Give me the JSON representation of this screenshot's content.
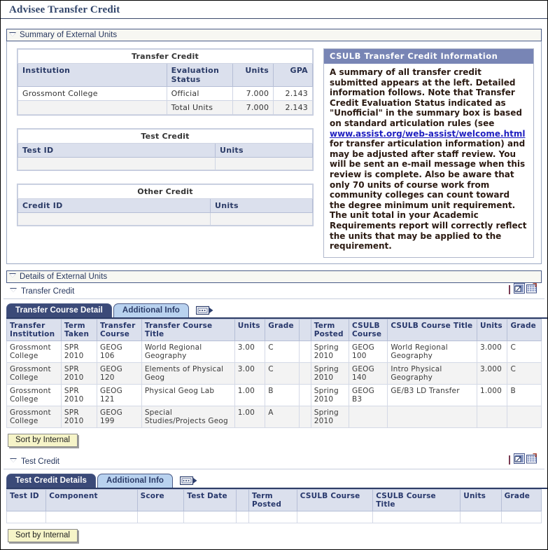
{
  "page": {
    "title": "Advisee Transfer Credit"
  },
  "summary_section": {
    "group_label": "Summary of External Units",
    "transfer_credit_table": {
      "caption": "Transfer Credit",
      "columns": [
        "Institution",
        "Evaluation Status",
        "Units",
        "GPA"
      ],
      "rows": [
        [
          "Grossmont College",
          "Official",
          "7.000",
          "2.143"
        ],
        [
          "",
          "Total Units",
          "7.000",
          "2.143"
        ]
      ]
    },
    "test_credit_table": {
      "caption": "Test Credit",
      "columns": [
        "Test ID",
        "Units"
      ],
      "rows": [
        [
          "",
          ""
        ]
      ]
    },
    "other_credit_table": {
      "caption": "Other Credit",
      "columns": [
        "Credit ID",
        "Units"
      ],
      "rows": [
        [
          "",
          ""
        ]
      ]
    },
    "info_box": {
      "heading": "CSULB Transfer Credit Information",
      "text_before_link": "A summary of all transfer credit submitted appears at the left. Detailed information follows. Note that Transfer Credit Evaluation Status indicated as \"Unofficial\" in the summary box is based on standard articulation rules (see ",
      "link_text": "www.assist.org/web-assist/welcome.html",
      "text_after_link": " for transfer articulation information) and may be adjusted after staff review. You will be sent an e-mail message when this review is complete. Also be aware that only 70 units of course work from community colleges can count toward the degree minimum unit requirement. The unit total in your Academic Requirements report will correctly reflect the units that may be applied to the requirement."
    }
  },
  "details_section": {
    "group_label": "Details of External Units",
    "transfer_credit": {
      "sub_label": "Transfer Credit",
      "tabs": [
        {
          "label": "Transfer Course Detail",
          "active": true
        },
        {
          "label": "Additional Info",
          "active": false
        }
      ],
      "expand_icon": "show-all-columns-icon",
      "new_window_icon": "new-window-icon",
      "download_icon": "download-to-excel-icon",
      "columns": [
        "Transfer Institution",
        "Term Taken",
        "Transfer Course",
        "Transfer Course Title",
        "Units",
        "Grade",
        "",
        "Term Posted",
        "CSULB Course",
        "CSULB Course Title",
        "Units",
        "Grade"
      ],
      "rows": [
        [
          "Grossmont College",
          "SPR 2010",
          "GEOG 106",
          "World Regional Geography",
          "3.00",
          "C",
          "",
          "Spring 2010",
          "GEOG 100",
          "World Regional Geography",
          "3.000",
          "C"
        ],
        [
          "Grossmont College",
          "SPR 2010",
          "GEOG 120",
          "Elements of Physical Geog",
          "3.00",
          "C",
          "",
          "Spring 2010",
          "GEOG 140",
          "Intro Physical Geography",
          "3.000",
          "C"
        ],
        [
          "Grossmont College",
          "SPR 2010",
          "GEOG 121",
          "Physical Geog Lab",
          "1.00",
          "B",
          "",
          "Spring 2010",
          "GEOG B3",
          "GE/B3 LD Transfer",
          "1.000",
          "B"
        ],
        [
          "Grossmont College",
          "SPR 2010",
          "GEOG 199",
          "Special Studies/Projects Geog",
          "1.00",
          "A",
          "",
          "Spring 2010",
          "",
          "",
          "",
          ""
        ]
      ],
      "sort_button": "Sort by Internal"
    },
    "test_credit": {
      "sub_label": "Test Credit",
      "tabs": [
        {
          "label": "Test Credit Details",
          "active": true
        },
        {
          "label": "Additional Info",
          "active": false
        }
      ],
      "expand_icon": "show-all-columns-icon",
      "new_window_icon": "new-window-icon",
      "download_icon": "download-to-excel-icon",
      "columns": [
        "Test ID",
        "Component",
        "Score",
        "Test Date",
        "",
        "Term Posted",
        "CSULB Course",
        "CSULB Course Title",
        "Units",
        "Grade"
      ],
      "rows": [
        [
          "",
          "",
          "",
          "",
          "",
          "",
          "",
          "",
          "",
          ""
        ]
      ],
      "sort_button": "Sort by Internal"
    }
  },
  "colors": {
    "header_blue": "#7885b5",
    "tab_active": "#3b4a78",
    "tab_inactive": "#b9d2ef",
    "title_color": "#31456b",
    "link_color": "#1f1fc0",
    "button_yellow": "#f6f4c8"
  }
}
